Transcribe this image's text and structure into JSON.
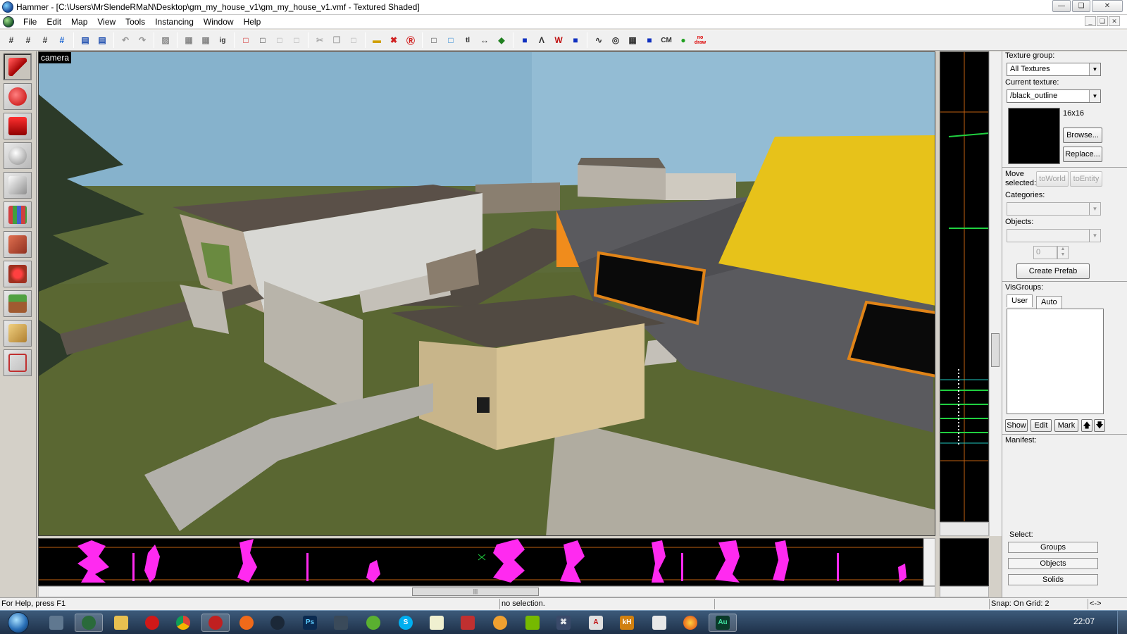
{
  "window": {
    "title": "Hammer - [C:\\Users\\MrSlendeRMaN\\Desktop\\gm_my_house_v1\\gm_my_house_v1.vmf - Textured Shaded]"
  },
  "menu": {
    "items": [
      "File",
      "Edit",
      "Map",
      "View",
      "Tools",
      "Instancing",
      "Window",
      "Help"
    ]
  },
  "toolbar": {
    "text_buttons": {
      "ig": "ig",
      "tl": "tl",
      "cm": "CM",
      "nodraw": "no draw"
    }
  },
  "viewport": {
    "camera_label": "camera"
  },
  "texture_panel": {
    "texture_group_label": "Texture group:",
    "texture_group_value": "All Textures",
    "current_texture_label": "Current texture:",
    "current_texture_value": "/black_outline",
    "texture_size": "16x16",
    "browse_label": "Browse...",
    "replace_label": "Replace...",
    "move_selected_label": "Move selected:",
    "to_world_label": "toWorld",
    "to_entity_label": "toEntity",
    "categories_label": "Categories:",
    "objects_label": "Objects:",
    "spin_value": "0",
    "create_prefab_label": "Create Prefab",
    "visgroups_label": "VisGroups:",
    "tab_user": "User",
    "tab_auto": "Auto",
    "show_label": "Show",
    "edit_label": "Edit",
    "mark_label": "Mark",
    "manifest_label": "Manifest:",
    "select_label": "Select:",
    "groups_label": "Groups",
    "objects_btn_label": "Objects",
    "solids_label": "Solids"
  },
  "status_bar": {
    "help": "For Help, press F1",
    "selection": "no selection.",
    "snap": "Snap: On Grid: 2",
    "extra": "<->"
  },
  "taskbar": {
    "clock": "22:07"
  },
  "colors": {
    "sky": "#8ab6d0",
    "grass": "#5c6a38",
    "roof_yellow": "#e7c21a",
    "window_orange": "#e08418",
    "ortho_magenta": "#ff2af0",
    "ortho_green": "#20d040"
  }
}
